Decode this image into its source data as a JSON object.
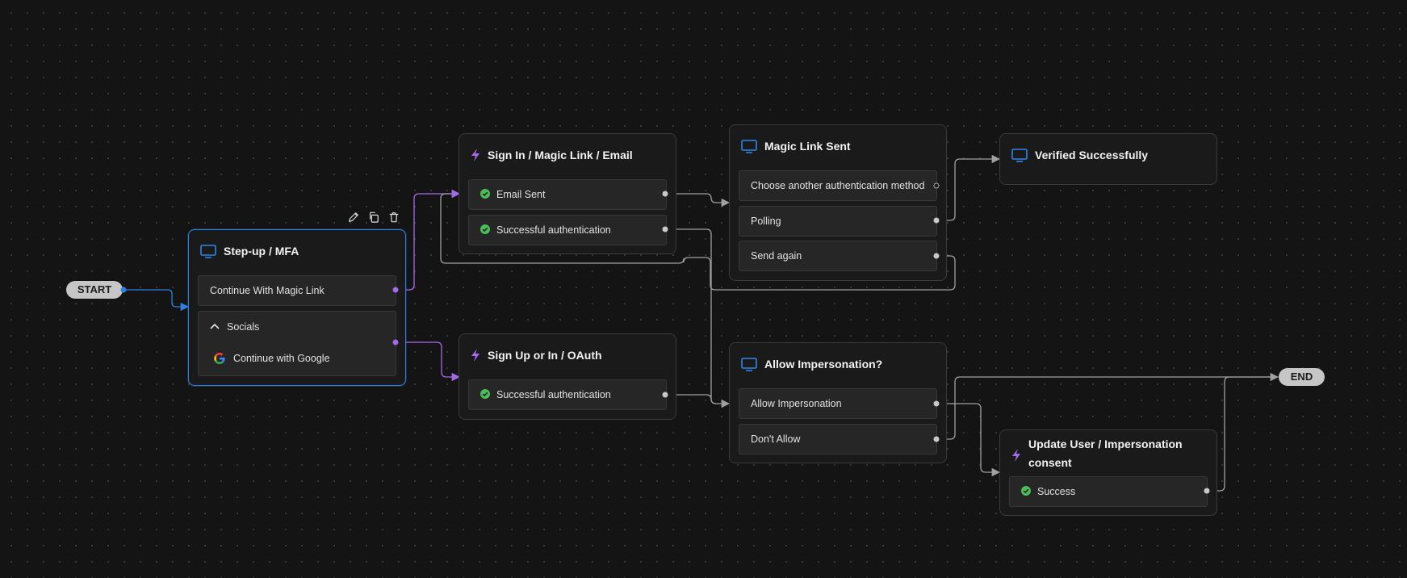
{
  "start_label": "START",
  "end_label": "END",
  "nodes": {
    "stepup": {
      "title": "Step-up / MFA",
      "icon": "monitor-icon",
      "rows": [
        "Continue With Magic Link"
      ],
      "group_label": "Socials",
      "group_item": "Continue with Google"
    },
    "signin_magic": {
      "title": "Sign In / Magic Link / Email",
      "icon": "bolt-icon",
      "rows": [
        "Email Sent",
        "Successful authentication"
      ]
    },
    "signup_oauth": {
      "title": "Sign Up or In / OAuth",
      "icon": "bolt-icon",
      "rows": [
        "Successful authentication"
      ]
    },
    "magic_sent": {
      "title": "Magic Link Sent",
      "icon": "monitor-icon",
      "rows": [
        "Choose another authentication method",
        "Polling",
        "Send again"
      ]
    },
    "verified": {
      "title": "Verified Successfully",
      "icon": "monitor-icon",
      "rows": []
    },
    "impersonation": {
      "title": "Allow Impersonation?",
      "icon": "monitor-icon",
      "rows": [
        "Allow Impersonation",
        "Don't Allow"
      ]
    },
    "update_user": {
      "title_line1": "Update User / Impersonation",
      "title_line2": "consent",
      "icon": "bolt-icon",
      "rows": [
        "Success"
      ]
    }
  },
  "toolbar": [
    "edit-icon",
    "duplicate-icon",
    "delete-icon"
  ],
  "colors": {
    "background": "#141414",
    "selected_border": "#2d7fe0",
    "screen_icon": "#2f86ea",
    "action_icon": "#a36be8",
    "success_check": "#4cbc5a",
    "edge_default": "#9a9a9a",
    "edge_purple": "#a36be8",
    "edge_blue": "#2d7fe0"
  }
}
